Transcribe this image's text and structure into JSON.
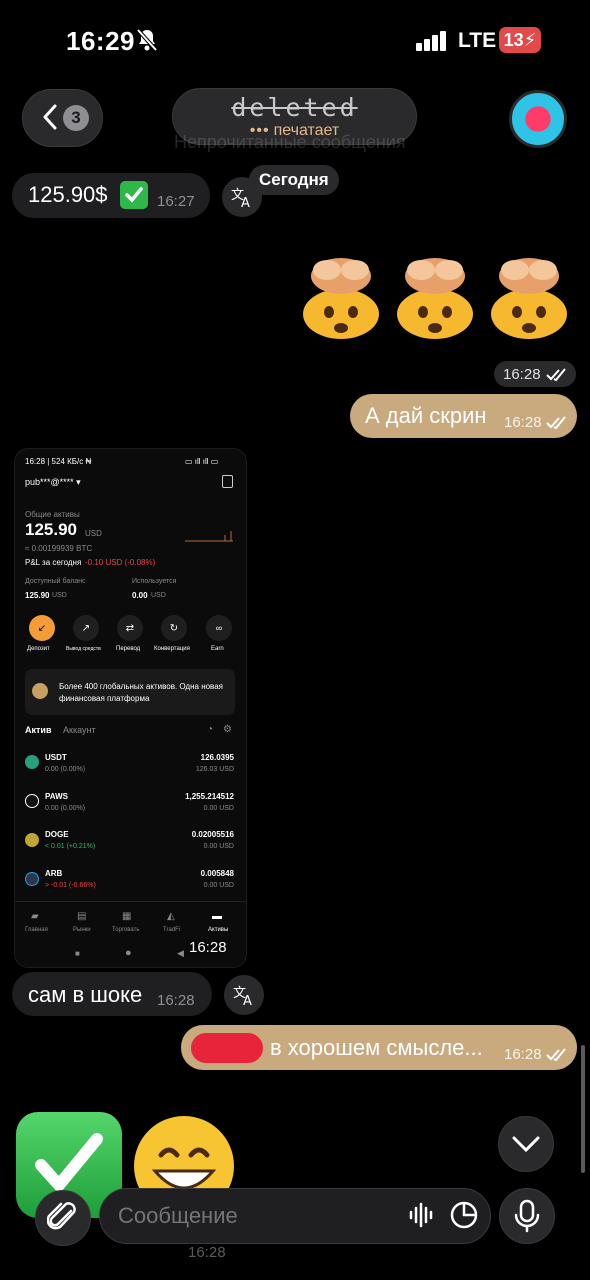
{
  "status_bar": {
    "time": "16:29",
    "network": "LTE",
    "battery": "13"
  },
  "header": {
    "back_count": "3",
    "title": "deleted",
    "typing_status": "печатает",
    "typing_dots": "•••",
    "ghost_lines": [
      "Непрочитанные сообщения"
    ]
  },
  "date_chip": "Сегодня",
  "messages": [
    {
      "text": "125.90$",
      "time": "16:27"
    },
    {
      "time": "16:28"
    },
    {
      "text": "А дай скрин",
      "time": "16:28"
    },
    {
      "time": "16:28"
    },
    {
      "text": "сам в шоке",
      "time": "16:28"
    },
    {
      "text": "в хорошем смысле...",
      "time": "16:28"
    },
    {
      "time": "16:28"
    }
  ],
  "screenshot": {
    "status_time": "16:28 | 524 КБ/с ₦",
    "account": "pub***@****",
    "total_label": "Общие активы",
    "balance": "125.90",
    "balance_unit": "USD",
    "btc": "≈ 0.00199939 BTC",
    "pnl_label": "P&L за сегодня",
    "pnl_value": "-0.10 USD (-0.08%)",
    "available_label": "Доступный баланс",
    "available_value": "125.90",
    "used_label": "Используется",
    "used_value": "0.00",
    "unit": "USD",
    "actions": [
      "Депозит",
      "Вывод средств",
      "Перевод",
      "Конвертация",
      "Earn"
    ],
    "banner": "Более 400 глобальных активов. Одна новая финансовая платформа",
    "tabs": [
      "Актив",
      "Аккаунт"
    ],
    "assets": [
      {
        "name": "USDT",
        "change": "0.00 (0.00%)",
        "amount": "126.0395",
        "usd": "126.03 USD",
        "color": "#26a17b"
      },
      {
        "name": "PAWS",
        "change": "0.00 (0.00%)",
        "amount": "1,255.214512",
        "usd": "0.00 USD",
        "color": "#ffffff"
      },
      {
        "name": "DOGE",
        "change": "< 0.01 (+0.21%)",
        "amount": "0.02005516",
        "usd": "0.00 USD",
        "color": "#c2a633"
      },
      {
        "name": "ARB",
        "change": "> -0.01 (-0.66%)",
        "amount": "0.005848",
        "usd": "0.00 USD",
        "color": "#2d374b"
      }
    ],
    "nav": [
      "Главная",
      "Рынки",
      "Торговать",
      "TradFi",
      "Активы"
    ],
    "bubble_time": "16:28"
  },
  "input": {
    "placeholder": "Сообщение"
  },
  "colors": {
    "outgoing_bubble": "#c9a97e",
    "incoming_bubble": "#1f1f21",
    "background": "#000000"
  }
}
